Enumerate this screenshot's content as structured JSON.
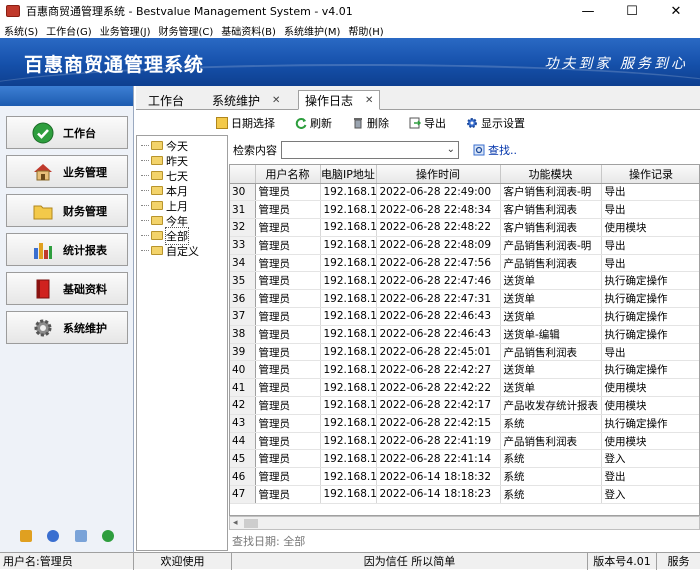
{
  "window": {
    "title": "百惠商贸通管理系统 - Bestvalue Management System - v4.01",
    "minimize": "—",
    "maximize": "☐",
    "close": "✕"
  },
  "menu": [
    "系统(S)",
    "工作台(G)",
    "业务管理(J)",
    "财务管理(C)",
    "基础资料(B)",
    "系统维护(M)",
    "帮助(H)"
  ],
  "banner": {
    "title": "百惠商贸通管理系统",
    "slogan": "功夫到家 服务到心"
  },
  "sidebar": {
    "items": [
      {
        "label": "工作台",
        "icon": "checkmark-icon"
      },
      {
        "label": "业务管理",
        "icon": "house-icon"
      },
      {
        "label": "财务管理",
        "icon": "folder-icon"
      },
      {
        "label": "统计报表",
        "icon": "bar-chart-icon"
      },
      {
        "label": "基础资料",
        "icon": "book-icon"
      },
      {
        "label": "系统维护",
        "icon": "gear-icon"
      }
    ]
  },
  "tabs": [
    {
      "label": "工作台",
      "closable": false
    },
    {
      "label": "系统维护",
      "closable": true
    },
    {
      "label": "操作日志",
      "closable": true
    }
  ],
  "tab_close": "✕",
  "toolbar": {
    "date_select": "日期选择",
    "refresh": "刷新",
    "delete": "删除",
    "export": "导出",
    "display_settings": "显示设置"
  },
  "tree": [
    "今天",
    "昨天",
    "七天",
    "本月",
    "上月",
    "今年",
    "全部",
    "自定义"
  ],
  "tree_selected": "全部",
  "search": {
    "label": "检索内容",
    "value": "",
    "find": "查找.."
  },
  "table": {
    "headers": [
      "",
      "用户名称",
      "电脑IP地址",
      "操作时间",
      "功能模块",
      "操作记录"
    ],
    "rows": [
      [
        "30",
        "管理员",
        "192.168.1",
        "2022-06-28 22:49:00",
        "客户销售利润表-明",
        "导出"
      ],
      [
        "31",
        "管理员",
        "192.168.1",
        "2022-06-28 22:48:34",
        "客户销售利润表",
        "导出"
      ],
      [
        "32",
        "管理员",
        "192.168.1",
        "2022-06-28 22:48:22",
        "客户销售利润表",
        "使用模块"
      ],
      [
        "33",
        "管理员",
        "192.168.1",
        "2022-06-28 22:48:09",
        "产品销售利润表-明",
        "导出"
      ],
      [
        "34",
        "管理员",
        "192.168.1",
        "2022-06-28 22:47:56",
        "产品销售利润表",
        "导出"
      ],
      [
        "35",
        "管理员",
        "192.168.1",
        "2022-06-28 22:47:46",
        "送货单",
        "执行确定操作"
      ],
      [
        "36",
        "管理员",
        "192.168.1",
        "2022-06-28 22:47:31",
        "送货单",
        "执行确定操作"
      ],
      [
        "37",
        "管理员",
        "192.168.1",
        "2022-06-28 22:46:43",
        "送货单",
        "执行确定操作"
      ],
      [
        "38",
        "管理员",
        "192.168.1",
        "2022-06-28 22:46:43",
        "送货单-编辑",
        "执行确定操作"
      ],
      [
        "39",
        "管理员",
        "192.168.1",
        "2022-06-28 22:45:01",
        "产品销售利润表",
        "导出"
      ],
      [
        "40",
        "管理员",
        "192.168.1",
        "2022-06-28 22:42:27",
        "送货单",
        "执行确定操作"
      ],
      [
        "41",
        "管理员",
        "192.168.1",
        "2022-06-28 22:42:22",
        "送货单",
        "使用模块"
      ],
      [
        "42",
        "管理员",
        "192.168.1",
        "2022-06-28 22:42:17",
        "产品收发存统计报表",
        "使用模块"
      ],
      [
        "43",
        "管理员",
        "192.168.1",
        "2022-06-28 22:42:15",
        "系统",
        "执行确定操作"
      ],
      [
        "44",
        "管理员",
        "192.168.1",
        "2022-06-28 22:41:19",
        "产品销售利润表",
        "使用模块"
      ],
      [
        "45",
        "管理员",
        "192.168.1",
        "2022-06-28 22:41:14",
        "系统",
        "登入"
      ],
      [
        "46",
        "管理员",
        "192.168.1",
        "2022-06-14 18:18:32",
        "系统",
        "登出"
      ],
      [
        "47",
        "管理员",
        "192.168.1",
        "2022-06-14 18:18:23",
        "系统",
        "登入"
      ]
    ]
  },
  "filter_line": "查找日期: 全部",
  "statusbar": {
    "user": "用户名:管理员",
    "welcome": "欢迎使用",
    "motto": "因为信任 所以简单",
    "version": "版本号4.01",
    "service": "服务"
  },
  "colors": {
    "banner": "#1550aa",
    "accent": "#2a69c4"
  }
}
